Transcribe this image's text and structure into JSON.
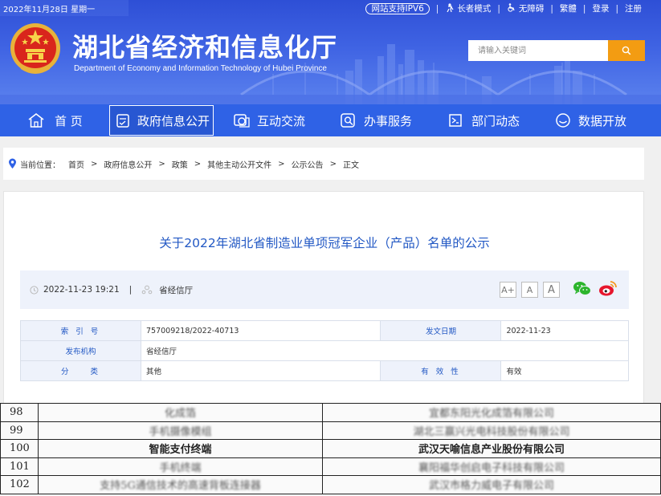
{
  "header": {
    "date_line": "2022年11月28日 星期一",
    "title": "湖北省经济和信息化厅",
    "subtitle": "Department of Economy and Information Technology of Hubei Province",
    "top_links": {
      "ipv6": "网站支持IPV6",
      "elder_mode": "长者模式",
      "accessibility": "无障碍",
      "traditional": "繁體",
      "login": "登录",
      "register": "注册"
    },
    "search": {
      "placeholder": "请输入关键词"
    }
  },
  "nav": {
    "items": [
      {
        "label": "首 页",
        "icon": "home-icon"
      },
      {
        "label": "政府信息公开",
        "icon": "document-check-icon",
        "active": true
      },
      {
        "label": "互动交流",
        "icon": "chat-icon"
      },
      {
        "label": "办事服务",
        "icon": "search-service-icon"
      },
      {
        "label": "部门动态",
        "icon": "news-icon"
      },
      {
        "label": "数据开放",
        "icon": "smile-data-icon"
      }
    ]
  },
  "breadcrumb": {
    "label": "当前位置：",
    "items": [
      "首页",
      "政府信息公开",
      "政策",
      "其他主动公开文件",
      "公示公告",
      "正文"
    ]
  },
  "article": {
    "title": "关于2022年湖北省制造业单项冠军企业（产品）名单的公示",
    "datetime": "2022-11-23 19:21",
    "source": "省经信厅",
    "font_buttons": [
      "A+",
      "A",
      "A"
    ],
    "share": [
      "wechat-icon",
      "weibo-icon"
    ],
    "info": {
      "index_label": "索 引 号",
      "index_value": "757009218/2022-40713",
      "date_label": "发文日期",
      "date_value": "2022-11-23",
      "publisher_label": "发布机构",
      "publisher_value": "省经信厅",
      "category_label": "分    类",
      "category_value": "其他",
      "validity_label": "有 效 性",
      "validity_value": "有效"
    }
  },
  "scanned_table": {
    "rows": [
      {
        "no": "98",
        "product": "化成箔",
        "company": "宜都东阳光化成箔有限公司"
      },
      {
        "no": "99",
        "product": "手机摄像模组",
        "company": "湖北三赢兴光电科技股份有限公司"
      },
      {
        "no": "100",
        "product": "智能支付终端",
        "company": "武汉天喻信息产业股份有限公司"
      },
      {
        "no": "101",
        "product": "手机终端",
        "company": "襄阳福华创启电子科技有限公司"
      },
      {
        "no": "102",
        "product": "支持5G通信技术的高速背板连接器",
        "company": "武汉市格力威电子有限公司"
      }
    ]
  },
  "colors": {
    "banner": "#3f63e3",
    "nav": "#2f62e6",
    "accent_blue": "#2258c4",
    "search_button": "#f39c12"
  }
}
